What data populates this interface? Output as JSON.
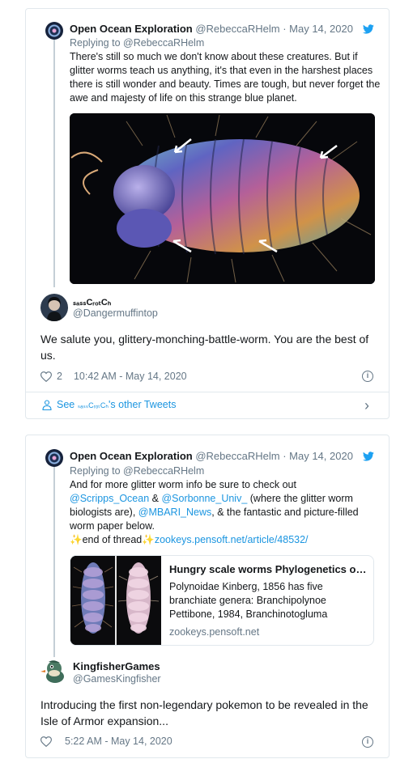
{
  "tweet1": {
    "parent": {
      "display_name": "Open Ocean Exploration",
      "handle": "@RebeccaRHelm",
      "date": "May 14, 2020",
      "reply_prefix": "Replying to",
      "reply_to": "@RebeccaRHelm",
      "text": "There's still so much we don't know about these creatures. But if glitter worms teach us anything, it's that even in the harshest places there is still wonder and beauty. Times are tough, but never forget the awe and majesty of life on this strange blue planet."
    },
    "author_name": "ₛₐₛₛCᵣₒₜCₕ",
    "handle": "@Dangermuffintop",
    "text": "We salute you, glittery-monching-battle-worm.  You are the best of us.",
    "likes": "2",
    "timestamp": "10:42 AM - May 14, 2020",
    "see_other_prefix": "See",
    "see_other_name": "ₛₐₛₛCᵣₒₜCₕ",
    "see_other_suffix": "'s other Tweets"
  },
  "tweet2": {
    "parent": {
      "display_name": "Open Ocean Exploration",
      "handle": "@RebeccaRHelm",
      "date": "May 14, 2020",
      "reply_prefix": "Replying to",
      "reply_to": "@RebeccaRHelm",
      "text_1": "And for more glitter worm info be sure to check out",
      "mention_1": "@Scripps_Ocean",
      "amp_1": "&",
      "mention_2": "@Sorbonne_Univ_",
      "text_2": "(where the glitter worm biologists are),",
      "mention_3": "@MBARI_News",
      "text_3": ", & the fantastic and picture-filled worm paper below.",
      "sparkle": "✨",
      "text_4": "end of thread",
      "url": "zookeys.pensoft.net/article/48532/",
      "card": {
        "title": "Hungry scale worms Phylogenetics of...",
        "description": "Polynoidae Kinberg, 1856 has five branchiate genera: Branchipolynoe Pettibone, 1984, Branchinotogluma",
        "domain": "zookeys.pensoft.net"
      }
    },
    "author_name": "KingfisherGames",
    "handle": "@GamesKingfisher",
    "text": "Introducing the first non-legendary pokemon to be revealed in the Isle of Armor expansion...",
    "timestamp": "5:22 AM - May 14, 2020"
  },
  "icons": {
    "twitter_bird": "twitter-bird-icon",
    "heart": "heart-icon",
    "info": "info-icon",
    "info_glyph": "i",
    "person": "person-icon",
    "chevron": "chevron-right-icon",
    "chevron_glyph": "›"
  },
  "colors": {
    "link": "#1b95e0",
    "muted": "#657786",
    "border": "#e1e8ed"
  }
}
